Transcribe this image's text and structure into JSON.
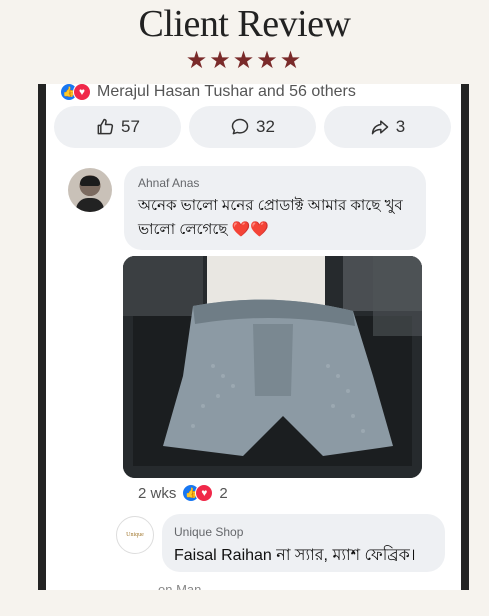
{
  "header": {
    "title": "Client Review",
    "stars": "★★★★★"
  },
  "post": {
    "reacted_by": "Merajul Hasan Tushar and 56 others",
    "actions": {
      "likes": "57",
      "comments": "32",
      "shares": "3"
    }
  },
  "comment": {
    "author": "Ahnaf Anas",
    "text": "অনেক ভালো মনের প্রোডাক্ট আমার কাছে খুব ভালো লেগেছে",
    "hearts": "❤️❤️",
    "time": "2 wks",
    "reaction_count": "2"
  },
  "reply": {
    "avatar_text": "Unique",
    "author": "Unique Shop",
    "text": "Faisal Raihan না স্যার, ম্যাশ ফেব্রিক।",
    "time_partial": "on Man"
  },
  "colors": {
    "like": "#1877f2",
    "love": "#f02849",
    "stars": "#7a2a2a"
  }
}
